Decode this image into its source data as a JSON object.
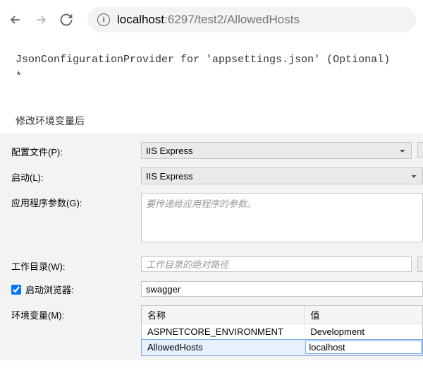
{
  "browser": {
    "url_prefix": "localhost",
    "url_suffix": ":6297/test2/AllowedHosts"
  },
  "page": {
    "line1": "JsonConfigurationProvider for 'appsettings.json' (Optional)",
    "line2": "*"
  },
  "section_title": "修改环境变量后",
  "form": {
    "profile_label": "配置文件(P):",
    "profile_value": "IIS Express",
    "launch_label": "启动(L):",
    "launch_value": "IIS Express",
    "args_label": "应用程序参数(G):",
    "args_placeholder": "要传递给应用程序的参数。",
    "workdir_label": "工作目录(W):",
    "workdir_placeholder": "工作目录的绝对路径",
    "launch_browser_label": "启动浏览器:",
    "launch_browser_checked": true,
    "launch_browser_value": "swagger",
    "env_label": "环境变量(M):",
    "env_table": {
      "col_name": "名称",
      "col_value": "值",
      "rows": [
        {
          "name": "ASPNETCORE_ENVIRONMENT",
          "value": "Development"
        },
        {
          "name": "AllowedHosts",
          "value": "localhost"
        }
      ]
    }
  }
}
